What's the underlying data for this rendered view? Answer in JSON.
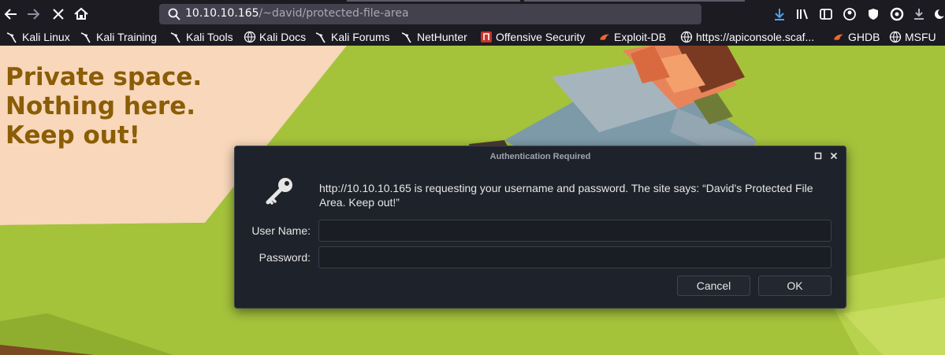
{
  "browser": {
    "url_host": "10.10.10.165",
    "url_path": "/~david/protected-file-area",
    "accent_color": "#42414d"
  },
  "toolbar_icons": {
    "back": "arrow-left-icon",
    "forward": "arrow-right-icon",
    "stop": "stop-loading-icon",
    "home": "home-icon",
    "search": "search-icon",
    "downloads": "download-arrow-icon",
    "library": "library-icon",
    "sidebar": "sidebar-icon",
    "account": "account-icon",
    "shield": "shield-icon",
    "extension": "extension-icon",
    "download2": "download-icon",
    "dark": "dark-mode-icon"
  },
  "bookmarks": [
    {
      "label": "Kali Linux",
      "icon": "kali-dragon-icon"
    },
    {
      "label": "Kali Training",
      "icon": "kali-dragon-icon"
    },
    {
      "label": "Kali Tools",
      "icon": "kali-dragon-icon"
    },
    {
      "label": "Kali Docs",
      "icon": "globe-icon"
    },
    {
      "label": "Kali Forums",
      "icon": "kali-dragon-icon"
    },
    {
      "label": "NetHunter",
      "icon": "kali-dragon-icon"
    },
    {
      "label": "Offensive Security",
      "icon": "offsec-icon"
    },
    {
      "label": "Exploit-DB",
      "icon": "exploit-db-icon"
    },
    {
      "label": "https://apiconsole.scaf...",
      "icon": "globe-icon"
    },
    {
      "label": "GHDB",
      "icon": "exploit-db-icon"
    },
    {
      "label": "MSFU",
      "icon": "globe-icon"
    }
  ],
  "page": {
    "lines": [
      "Private space.",
      "Nothing here.",
      "Keep out!"
    ]
  },
  "dialog": {
    "title": "Authentication Required",
    "message": "http://10.10.10.165 is requesting your username and password. The site says: “David's Protected File Area. Keep out!”",
    "username_label": "User Name:",
    "username_value": "",
    "password_label": "Password:",
    "password_value": "",
    "cancel_label": "Cancel",
    "ok_label": "OK"
  }
}
